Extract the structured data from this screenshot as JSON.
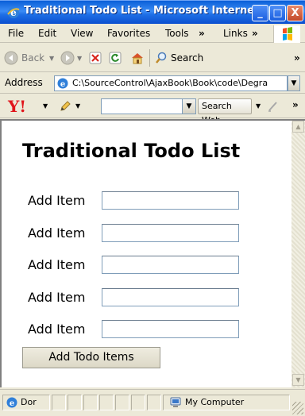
{
  "window": {
    "title": "Traditional Todo List - Microsoft Interne...",
    "min_label": "_",
    "max_label": "□",
    "close_label": "X"
  },
  "menu": {
    "file": "File",
    "edit": "Edit",
    "view": "View",
    "favorites": "Favorites",
    "tools": "Tools",
    "links": "Links",
    "chevron": "»"
  },
  "toolbar": {
    "back_label": "Back",
    "search_label": "Search",
    "chevron": "»"
  },
  "address": {
    "label": "Address",
    "value": "C:\\SourceControl\\AjaxBook\\Book\\code\\Degra"
  },
  "yahoo": {
    "logo": "Y!",
    "search_button": "Search Web",
    "chevron": "»"
  },
  "page": {
    "title": "Traditional Todo List",
    "rows": [
      {
        "label": "Add Item",
        "value": ""
      },
      {
        "label": "Add Item",
        "value": ""
      },
      {
        "label": "Add Item",
        "value": ""
      },
      {
        "label": "Add Item",
        "value": ""
      },
      {
        "label": "Add Item",
        "value": ""
      }
    ],
    "submit_label": "Add Todo Items"
  },
  "status": {
    "left_text": "Dor",
    "zone_text": "My Computer"
  },
  "colors": {
    "titlebar": "#0a5fd8",
    "chrome": "#ece9d8",
    "yahoo_red": "#e0151b"
  }
}
